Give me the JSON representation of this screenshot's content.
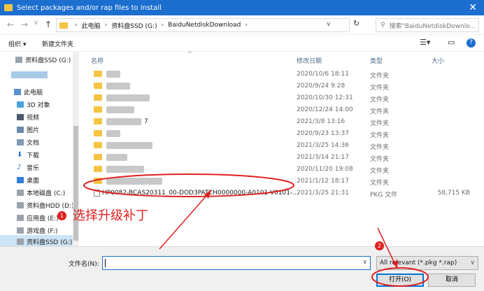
{
  "window": {
    "title": "Select packages and/or rap files to install",
    "close": "✕"
  },
  "address": {
    "crumbs": [
      "此电脑",
      "资料盘SSD (G:)",
      "BaiduNetdiskDownload"
    ],
    "search_placeholder": "搜索\"BaiduNetdiskDownlo..."
  },
  "toolbar": {
    "organize": "组织 ▾",
    "new_folder": "新建文件夹"
  },
  "nav": {
    "items": [
      {
        "label": "资料盘SSD (G:)",
        "icon": "drive-icon"
      },
      {
        "label": "",
        "icon": "blurred"
      },
      {
        "label": "此电脑",
        "icon": "computer-icon"
      },
      {
        "label": "3D 对象",
        "icon": "cube-icon"
      },
      {
        "label": "视频",
        "icon": "video-icon"
      },
      {
        "label": "图片",
        "icon": "picture-icon"
      },
      {
        "label": "文档",
        "icon": "document-icon"
      },
      {
        "label": "下载",
        "icon": "download-icon"
      },
      {
        "label": "音乐",
        "icon": "music-icon"
      },
      {
        "label": "桌面",
        "icon": "desktop-icon"
      },
      {
        "label": "本地磁盘 (C:)",
        "icon": "drive-icon"
      },
      {
        "label": "资料盘HDD (D:)",
        "icon": "drive-icon"
      },
      {
        "label": "应用盘 (E:)",
        "icon": "drive-icon"
      },
      {
        "label": "游戏盘 (F:)",
        "icon": "drive-icon"
      },
      {
        "label": "资料盘SSD (G:)",
        "icon": "drive-icon"
      }
    ]
  },
  "columns": {
    "name": "名称",
    "date": "修改日期",
    "type": "类型",
    "size": "大小"
  },
  "files": [
    {
      "name": "",
      "date": "2020/10/6 18:11",
      "type": "文件夹",
      "size": ""
    },
    {
      "name": "",
      "date": "2020/9/24 9:28",
      "type": "文件夹",
      "size": ""
    },
    {
      "name": "",
      "date": "2020/10/30 12:31",
      "type": "文件夹",
      "size": ""
    },
    {
      "name": "",
      "date": "2020/12/24 14:00",
      "type": "文件夹",
      "size": ""
    },
    {
      "name": "7",
      "date": "2021/3/8 13:16",
      "type": "文件夹",
      "size": ""
    },
    {
      "name": "",
      "date": "2020/9/23 13:37",
      "type": "文件夹",
      "size": ""
    },
    {
      "name": "",
      "date": "2021/3/25 14:36",
      "type": "文件夹",
      "size": ""
    },
    {
      "name": "",
      "date": "2021/3/14 21:17",
      "type": "文件夹",
      "size": ""
    },
    {
      "name": "",
      "date": "2020/11/20 19:08",
      "type": "文件夹",
      "size": ""
    },
    {
      "name": "",
      "date": "2021/1/12 18:17",
      "type": "文件夹",
      "size": ""
    },
    {
      "name": "HP0082-BCAS20311_00-DOD3PATCH0000000-A0101-V0101-...",
      "date": "2021/3/25 21:31",
      "type": "PKG 文件",
      "size": "58,715 KB"
    }
  ],
  "footer": {
    "filename_label": "文件名(N):",
    "filter": "All relevant (*.pkg *.rap)",
    "open": "打开(O)",
    "cancel": "取消"
  },
  "annotations": {
    "badge1": "1",
    "badge2": "2",
    "text1": "选择升级补丁"
  },
  "colors": {
    "accent": "#1c6ecf",
    "annotation": "#e02020"
  }
}
